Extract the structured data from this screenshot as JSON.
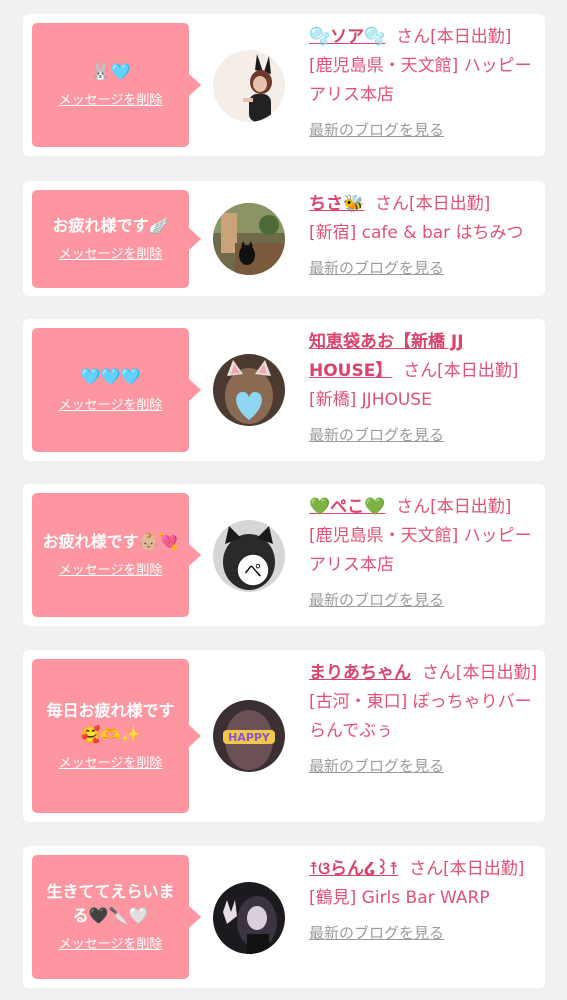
{
  "colors": {
    "page_bg": "#f3f0f0",
    "card_bg": "#ffffff",
    "bubble_pink": "#fd96a1",
    "accent_pink": "#e25075",
    "link_gray": "#9b9b9b"
  },
  "cards": [
    {
      "message": "🐰🩵",
      "delete_label": "メッセージを削除",
      "cast_name": "🫧ソア🫧",
      "san_status": "さん[本日出勤]",
      "shop": "[鹿児島県・天文館] ハッピーアリス本店",
      "blog_label": "最新のブログを見る",
      "avatar_icon": "bunny-ears-photo-icon"
    },
    {
      "message": "お疲れ様です🪽",
      "delete_label": "メッセージを削除",
      "cast_name": "ちさ🐝",
      "san_status": "さん[本日出勤]",
      "shop": "[新宿] cafe & bar はちみつ",
      "blog_label": "最新のブログを見る",
      "avatar_icon": "cat-on-wall-photo-icon"
    },
    {
      "message": "🩵🩵🩵",
      "delete_label": "メッセージを削除",
      "cast_name": "知恵袋あお【新橋 JJ HOUSE】",
      "san_status": "さん[本日出勤]",
      "shop": "[新橋] JJHOUSE",
      "blog_label": "最新のブログを見る",
      "avatar_icon": "cat-ears-heart-photo-icon"
    },
    {
      "message": "お疲れ様です👶🏼💘",
      "delete_label": "メッセージを削除",
      "cast_name": "💚ぺこ💚",
      "san_status": "さん[本日出勤]",
      "shop": "[鹿児島県・天文館] ハッピーアリス本店",
      "blog_label": "最新のブログを見る",
      "avatar_icon": "cat-ears-pe-photo-icon"
    },
    {
      "message": "毎日お疲れ様です🥰🫶✨",
      "delete_label": "メッセージを削除",
      "cast_name": "まりあちゃん",
      "san_status": "さん[本日出勤]",
      "shop": "[古河・東口] ぽっちゃりバー らんでぶぅ",
      "blog_label": "最新のブログを見る",
      "avatar_icon": "happy-text-photo-icon"
    },
    {
      "message": "生きててえらいまる🖤🔪🤍",
      "delete_label": "メッセージを削除",
      "cast_name": "☨ଓらん໒꒱☨",
      "san_status": "さん[本日出勤]",
      "shop": "[鶴見] Girls Bar WARP",
      "blog_label": "最新のブログを見る",
      "avatar_icon": "peace-sign-photo-icon"
    }
  ]
}
